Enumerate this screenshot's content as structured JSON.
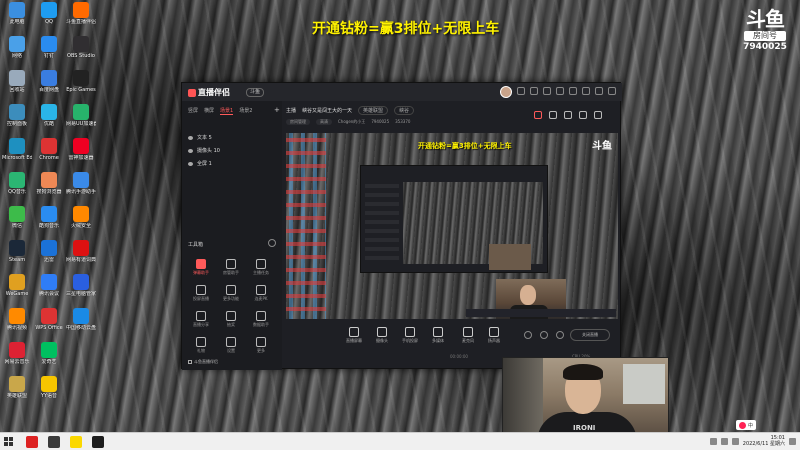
{
  "desktop": {
    "icons": [
      {
        "label": "此电脑",
        "color": "#3b8fe0"
      },
      {
        "label": "网络",
        "color": "#4aa0e8"
      },
      {
        "label": "回收站",
        "color": "#9ab"
      },
      {
        "label": "控制面板",
        "color": "#3c8dbc"
      },
      {
        "label": "Microsoft Edge",
        "color": "#1e90c0"
      },
      {
        "label": "QQ音乐",
        "color": "#2bb673"
      },
      {
        "label": "微信",
        "color": "#3dbb4a"
      },
      {
        "label": "Steam",
        "color": "#1b2838"
      },
      {
        "label": "WeGame",
        "color": "#e0a020"
      },
      {
        "label": "腾讯视频",
        "color": "#ff8a00"
      },
      {
        "label": "网易云音乐",
        "color": "#d23"
      },
      {
        "label": "英雄联盟",
        "color": "#c9a74a"
      },
      {
        "label": "QQ",
        "color": "#1e9cf0"
      },
      {
        "label": "钉钉",
        "color": "#2a8cf0"
      },
      {
        "label": "百度网盘",
        "color": "#3a7de0"
      },
      {
        "label": "优酷",
        "color": "#2ab5e8"
      },
      {
        "label": "Chrome",
        "color": "#d33"
      },
      {
        "label": "搜狗浏览器",
        "color": "#e85"
      },
      {
        "label": "酷狗音乐",
        "color": "#2a8cf0"
      },
      {
        "label": "迅雷",
        "color": "#1b72d8"
      },
      {
        "label": "腾讯会议",
        "color": "#2f7df6"
      },
      {
        "label": "WPS Office",
        "color": "#d33"
      },
      {
        "label": "爱奇艺",
        "color": "#00c060"
      },
      {
        "label": "YY语音",
        "color": "#f7c600"
      },
      {
        "label": "斗鱼直播伴侣",
        "color": "#ff6a00"
      },
      {
        "label": "OBS Studio",
        "color": "#302e31"
      },
      {
        "label": "Epic Games",
        "color": "#222"
      },
      {
        "label": "网易UU加速器",
        "color": "#27b36b"
      },
      {
        "label": "雷神加速器",
        "color": "#e02"
      },
      {
        "label": "腾讯手游助手",
        "color": "#3a8ae8"
      },
      {
        "label": "火绒安全",
        "color": "#f80"
      },
      {
        "label": "网易有道词典",
        "color": "#d11"
      },
      {
        "label": "三星电脑管家",
        "color": "#2a5fe0"
      },
      {
        "label": "中国移动云盘",
        "color": "#1a8ae6"
      }
    ]
  },
  "overlay": {
    "banner": "开通钻粉=赢3排位+无限上车",
    "logo_mark": "斗鱼",
    "room_label": "房间号",
    "room_number": "7940025"
  },
  "app": {
    "name": "直播伴侣",
    "badge": "斗鱼",
    "left_tabs": [
      "竖屏",
      "横屏",
      "场景1",
      "场景2"
    ],
    "scenes": [
      {
        "label": "文本 5"
      },
      {
        "label": "摄像头 10"
      },
      {
        "label": "全屏 1"
      }
    ],
    "tools_label": "工具箱",
    "tools": [
      {
        "label": "弹幕助手",
        "hot": true
      },
      {
        "label": "房管助手",
        "hot": false
      },
      {
        "label": "主播任务",
        "hot": false
      },
      {
        "label": "投屏直播",
        "hot": false
      },
      {
        "label": "更多功能",
        "hot": false
      },
      {
        "label": "连麦PK",
        "hot": false
      },
      {
        "label": "直播分享",
        "hot": false
      },
      {
        "label": "抽奖",
        "hot": false
      },
      {
        "label": "数据助手",
        "hot": false
      },
      {
        "label": "礼物",
        "hot": false
      },
      {
        "label": "设置",
        "hot": false
      },
      {
        "label": "更多",
        "hot": false
      }
    ],
    "footer_checkbox": "斗鱼直播伴侣",
    "info": {
      "host_label": "主播",
      "title": "峡谷又是闯王大的一天",
      "category_pill": "英雄联盟",
      "tag_pill": "峡谷",
      "room_pill": "房间管理",
      "quality_pill": "高清",
      "streamer": "Chogen的小王",
      "room_id": "7940025",
      "fans": "353370"
    },
    "preview_banner": "开通钻粉=赢3排位+无限上车",
    "preview_logo": "斗鱼",
    "controls": [
      {
        "label": "直播屏幕"
      },
      {
        "label": "摄像头"
      },
      {
        "label": "手机投屏"
      },
      {
        "label": "多媒体"
      },
      {
        "label": "麦克风"
      },
      {
        "label": "扬声器"
      }
    ],
    "start_button": "关闭直播",
    "status": {
      "left": "00:00:00",
      "right": "CPU 20%"
    }
  },
  "webcam": {
    "shirt_text": "IRONI"
  },
  "taskbar": {
    "apps": [
      {
        "color": "#d22"
      },
      {
        "color": "#3a3a3a"
      },
      {
        "color": "#fbd800"
      },
      {
        "color": "#1e1e1e"
      }
    ],
    "ime_label": "中",
    "time": "15:01",
    "date": "2022/6/11 星期六"
  }
}
